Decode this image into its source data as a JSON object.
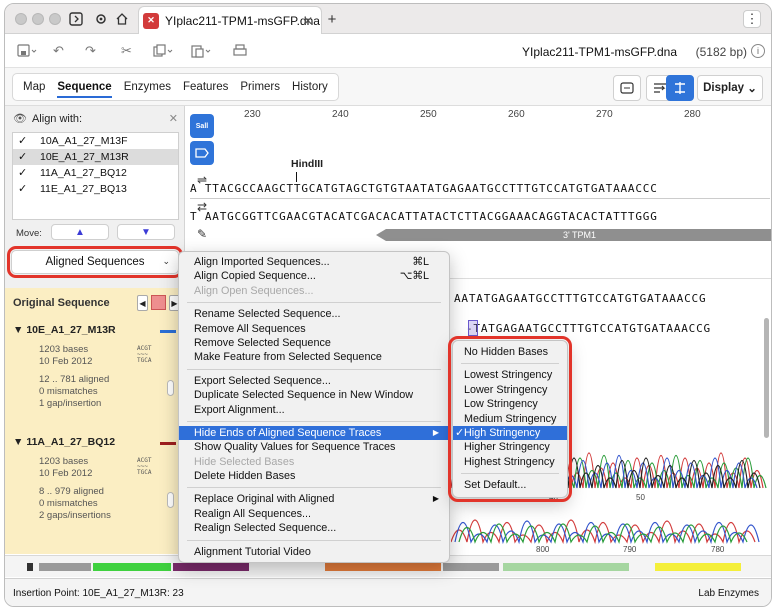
{
  "titlebar": {
    "tab_title": "YIplac211-TPM1-msGFP.dna",
    "favicon_text": "✕",
    "add_tab": "+",
    "more": "⋮"
  },
  "toolbar": {
    "filename": "YIplac211-TPM1-msGFP.dna",
    "bp_count": "(5182 bp)"
  },
  "view_tabs": [
    "Map",
    "Sequence",
    "Enzymes",
    "Features",
    "Primers",
    "History"
  ],
  "active_tab": "Sequence",
  "display_label": "Display",
  "left": {
    "align_with": "Align with:",
    "sequences": [
      {
        "label": "10A_A1_27_M13F",
        "checked": "✓"
      },
      {
        "label": "10E_A1_27_M13R",
        "checked": "✓"
      },
      {
        "label": "11A_A1_27_BQ12",
        "checked": "✓"
      },
      {
        "label": "11E_A1_27_BQ13",
        "checked": "✓"
      }
    ],
    "move_label": "Move:",
    "dropdown_value": "Aligned Sequences",
    "original_sequence": "Original Sequence",
    "reads": [
      {
        "name": "10E_A1_27_M13R",
        "bases": "1203 bases",
        "date": "10 Feb 2012",
        "aligned": "12 .. 781 aligned",
        "mismatches": "0 mismatches",
        "gaps": "1 gap/insertion"
      },
      {
        "name": "11A_A1_27_BQ12",
        "bases": "1203 bases",
        "date": "10 Feb 2012",
        "aligned": "8 .. 979 aligned",
        "mismatches": "0 mismatches",
        "gaps": "2 gaps/insertions"
      }
    ]
  },
  "main": {
    "ruler": [
      "230",
      "240",
      "250",
      "260",
      "270",
      "280"
    ],
    "enzyme": "HindIII",
    "top_strand": "A TTACGCCAAGCTTGCATGTAGCTGTGTAATATGAGAATGCCTTTGTCCATGTGATAAACCC",
    "bottom_strand": "T AATGCGGTTCGAACGTACATCGACACATTATACTCTTACGGAAACAGGTACACTATTTGGG",
    "feature": "3' TPM1",
    "aligned_strand": "AATATGAGAATGCCTTTGTCCATGTGATAAACCG",
    "read1_strand": "-TATGAGAATGCCTTTGTCCATGTGATAAACCG",
    "trace_ticks_1": [
      "40",
      "50"
    ],
    "trace_ticks_2": [
      "800",
      "790",
      "780"
    ]
  },
  "context_menu": {
    "items": [
      {
        "label": "Align Imported Sequences...",
        "shortcut": "⌘L",
        "disabled": false
      },
      {
        "label": "Align Copied Sequence...",
        "shortcut": "⌥⌘L",
        "disabled": false
      },
      {
        "label": "Align Open Sequences...",
        "shortcut": "",
        "disabled": true
      },
      {
        "label": "Rename Selected Sequence...",
        "shortcut": "",
        "disabled": false
      },
      {
        "label": "Remove All Sequences",
        "shortcut": "",
        "disabled": false
      },
      {
        "label": "Remove Selected Sequence",
        "shortcut": "",
        "disabled": false
      },
      {
        "label": "Make Feature from Selected Sequence",
        "shortcut": "",
        "disabled": false
      },
      {
        "label": "Export Selected Sequence...",
        "shortcut": "",
        "disabled": false
      },
      {
        "label": "Duplicate Selected Sequence in New Window",
        "shortcut": "",
        "disabled": false
      },
      {
        "label": "Export Alignment...",
        "shortcut": "",
        "disabled": false
      },
      {
        "label": "Hide Ends of Aligned Sequence Traces",
        "shortcut": "",
        "disabled": false
      },
      {
        "label": "Show Quality Values for Sequence Traces",
        "shortcut": "",
        "disabled": false
      },
      {
        "label": "Hide Selected Bases",
        "shortcut": "",
        "disabled": true
      },
      {
        "label": "Delete Hidden Bases",
        "shortcut": "",
        "disabled": false
      },
      {
        "label": "Replace Original with Aligned",
        "shortcut": "",
        "disabled": false
      },
      {
        "label": "Realign All Sequences...",
        "shortcut": "",
        "disabled": false
      },
      {
        "label": "Realign Selected Sequence...",
        "shortcut": "",
        "disabled": false
      },
      {
        "label": "Alignment Tutorial Video",
        "shortcut": "",
        "disabled": false
      }
    ]
  },
  "submenu": {
    "items": [
      "No Hidden Bases",
      "Lowest Stringency",
      "Lower Stringency",
      "Low Stringency",
      "Medium Stringency",
      "High Stringency",
      "Higher Stringency",
      "Highest Stringency",
      "Set Default..."
    ],
    "checked": "High Stringency",
    "check_mark": "✓"
  },
  "status": {
    "insertion_point": "Insertion Point:  10E_A1_27_M13R:  23",
    "enzymes": "Lab Enzymes"
  },
  "colors": {
    "accent": "#2f6fd9",
    "highlight_outline": "#e2342a",
    "original_panel": "#fbeec3",
    "feature_gray": "#8f8f8f"
  }
}
